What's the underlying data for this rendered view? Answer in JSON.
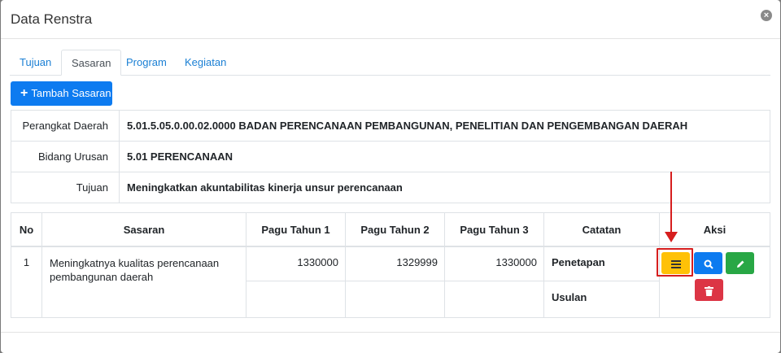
{
  "modal": {
    "title": "Data Renstra",
    "close_glyph": "×"
  },
  "tabs": [
    "Tujuan",
    "Sasaran",
    "Program",
    "Kegiatan"
  ],
  "active_tab": "Sasaran",
  "add_button": {
    "icon": "plus-icon",
    "label": "Tambah Sasaran"
  },
  "info": {
    "perangkat_label": "Perangkat Daerah",
    "perangkat_value": "5.01.5.05.0.00.02.0000 BADAN PERENCANAAN PEMBANGUNAN, PENELITIAN DAN PENGEMBANGAN DAERAH",
    "bidang_label": "Bidang Urusan",
    "bidang_value": "5.01 PERENCANAAN",
    "tujuan_label": "Tujuan",
    "tujuan_value": "Meningkatkan akuntabilitas kinerja unsur perencanaan"
  },
  "table": {
    "headers": [
      "No",
      "Sasaran",
      "Pagu Tahun 1",
      "Pagu Tahun 2",
      "Pagu Tahun 3",
      "Catatan",
      "Aksi"
    ],
    "row": {
      "no": "1",
      "sasaran": "Meningkatnya kualitas perencanaan pembangunan daerah",
      "pagu1": "1330000",
      "pagu2": "1329999",
      "pagu3": "1330000",
      "catatan1": "Penetapan",
      "catatan2": "Usulan"
    }
  },
  "action_buttons": [
    {
      "name": "menu-button",
      "icon": "list-icon",
      "color": "#ffc107"
    },
    {
      "name": "view-button",
      "icon": "search-icon",
      "color": "#0d7bf0"
    },
    {
      "name": "edit-button",
      "icon": "pencil-icon",
      "color": "#28a745"
    },
    {
      "name": "delete-button",
      "icon": "trash-icon",
      "color": "#dc3545"
    }
  ],
  "colors": {
    "primary": "#0d7bf0",
    "annotation": "#d61e1e"
  }
}
